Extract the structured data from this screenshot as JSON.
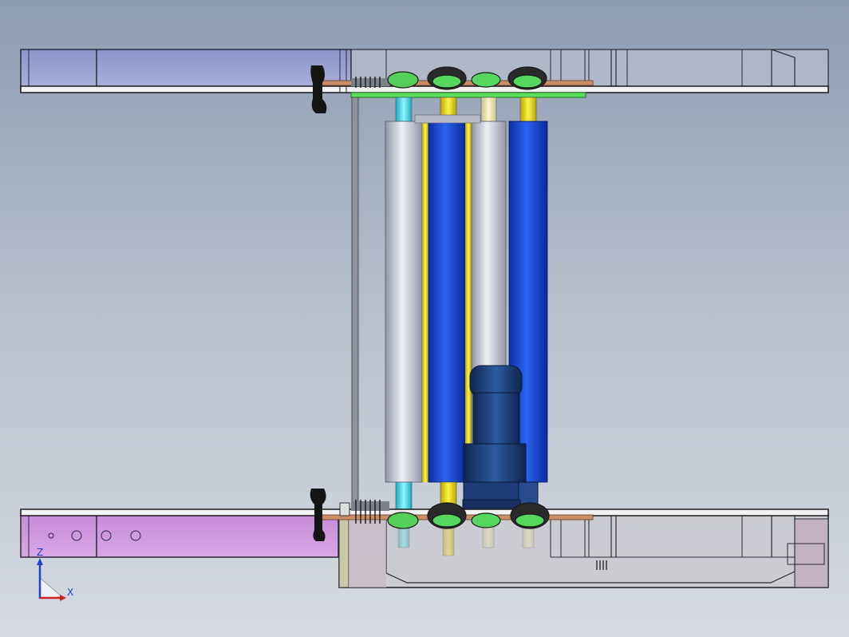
{
  "triad": {
    "z_label": "Z",
    "x_label": "X",
    "z_color": "#1f3fd6",
    "x_color": "#d42020"
  },
  "colors": {
    "background_top": "#8e9cb2",
    "background_bottom": "#d6dbe2",
    "top_frame_fill": "#9ea6cf",
    "bottom_frame_fill": "#c89ad6",
    "roller_blue": "#1f4fd6",
    "roller_silver": "#c8ccd8",
    "shaft_yellow": "#e8e020",
    "shaft_cyan": "#30d8e8",
    "plate_green": "#50e050",
    "motor_blue": "#1d3f7a",
    "frame_line": "#1a1a1a"
  }
}
